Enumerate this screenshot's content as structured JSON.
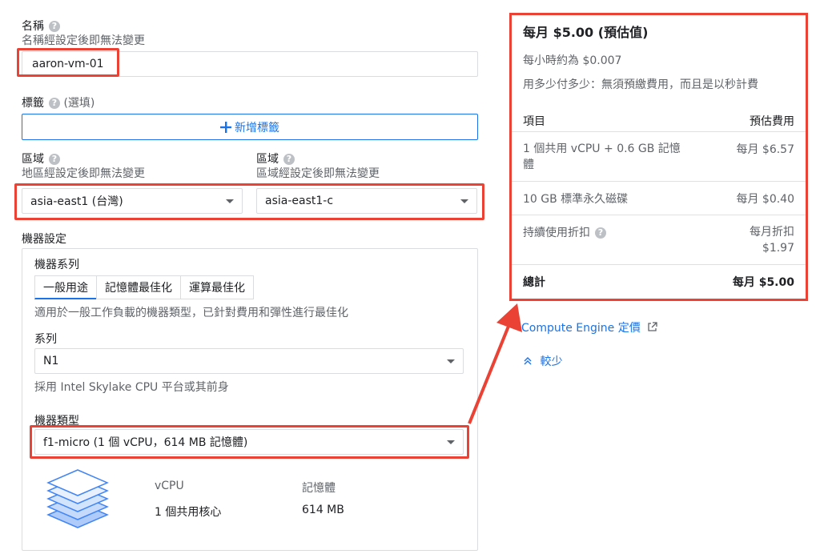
{
  "name_section": {
    "label": "名稱",
    "hint": "名稱經設定後即無法變更",
    "value": "aaron-vm-01"
  },
  "labels_section": {
    "label": "標籤",
    "optional": "(選填)",
    "add_button": "新增標籤"
  },
  "region": {
    "label": "區域",
    "hint": "地區經設定後即無法變更",
    "value": "asia-east1 (台灣)"
  },
  "zone": {
    "label": "區域",
    "hint": "區域經設定後即無法變更",
    "value": "asia-east1-c"
  },
  "machine_config": {
    "label": "機器設定",
    "family_label": "機器系列",
    "tabs": [
      "一般用途",
      "記憶體最佳化",
      "運算最佳化"
    ],
    "active_tab": "一般用途",
    "family_desc": "適用於一般工作負載的機器類型，已針對費用和彈性進行最佳化",
    "series_label": "系列",
    "series_value": "N1",
    "series_desc": "採用 Intel Skylake CPU 平台或其前身",
    "type_label": "機器類型",
    "type_value": "f1-micro (1 個 vCPU，614 MB 記憶體)",
    "vcpu_header": "vCPU",
    "vcpu_value": "1 個共用核心",
    "memory_header": "記憶體",
    "memory_value": "614 MB"
  },
  "cost": {
    "monthly_estimate": "每月 $5.00 (預估值)",
    "hourly": "每小時約為 $0.007",
    "pay_note": "用多少付多少：無須預繳費用，而且是以秒計費",
    "col_item": "項目",
    "col_cost": "預估費用",
    "rows": [
      {
        "item": "1 個共用 vCPU + 0.6 GB 記憶體",
        "cost": "每月 $6.57"
      },
      {
        "item": "10 GB 標準永久磁碟",
        "cost": "每月 $0.40"
      },
      {
        "item": "持續使用折扣",
        "cost": "每月折扣 $1.97"
      }
    ],
    "total_label": "總計",
    "total_value": "每月 $5.00"
  },
  "pricing_link": "Compute Engine 定價",
  "less_link": "較少",
  "colors": {
    "accent": "#1a73e8",
    "highlight": "#ea4335"
  },
  "icons": {
    "help": "help-circle-icon",
    "add": "plus-icon",
    "dropdown": "caret-down-icon",
    "external": "external-link-icon",
    "collapse": "chevron-up-icon",
    "machine": "stacked-layers-icon"
  }
}
